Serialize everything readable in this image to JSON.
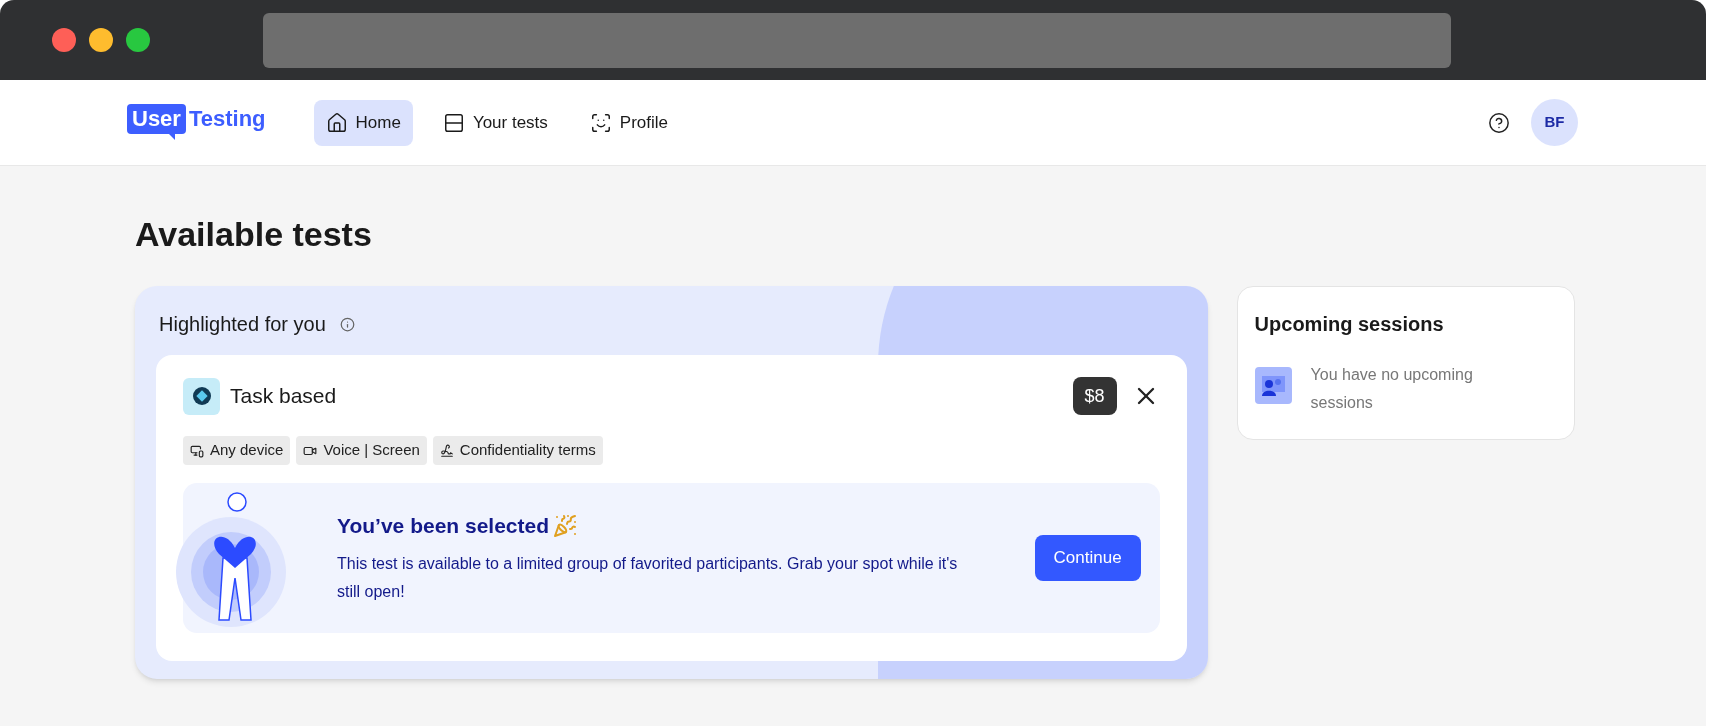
{
  "logo": {
    "part_1": "User",
    "part_2": "Testing"
  },
  "nav": [
    {
      "label": "Home",
      "kind": "home",
      "selected": true
    },
    {
      "label": "Your tests",
      "kind": "tests",
      "selected": false
    },
    {
      "label": "Profile",
      "kind": "profile",
      "selected": false
    }
  ],
  "avatar": "BF",
  "page_title": "Available tests",
  "highlighted": {
    "title": "Highlighted for you",
    "test": {
      "name": "Task based",
      "price": "$8",
      "tags": [
        {
          "label": "Any device",
          "kind": "device"
        },
        {
          "label": "Voice | Screen",
          "kind": "video"
        },
        {
          "label": "Confidentiality terms",
          "kind": "sign"
        }
      ],
      "banner": {
        "title": "You’ve been selected",
        "text": "This test is available to a limited group of favorited participants. Grab your spot while it's still open!",
        "button": "Continue"
      }
    }
  },
  "upcoming": {
    "title": "Upcoming sessions",
    "empty_text": "You have no upcoming sessions"
  }
}
